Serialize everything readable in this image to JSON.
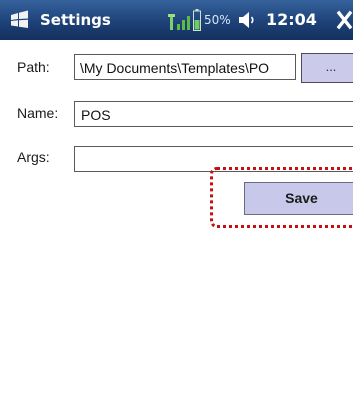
{
  "titlebar": {
    "title": "Settings",
    "battery": "50%",
    "clock": "12:04",
    "start_icon": "windows-flag-icon",
    "signal_icon": "signal-icon",
    "battery_icon": "battery-icon",
    "volume_icon": "speaker-icon",
    "close_icon": "close-icon"
  },
  "form": {
    "path": {
      "label": "Path:",
      "value": "\\My Documents\\Templates\\PO"
    },
    "browse_label": "...",
    "name": {
      "label": "Name:",
      "value": "POS"
    },
    "args": {
      "label": "Args:",
      "value": ""
    },
    "save_label": "Save"
  },
  "colors": {
    "titlebar": "#1d4278",
    "button": "#c8c8ea",
    "highlight": "#c41010"
  }
}
